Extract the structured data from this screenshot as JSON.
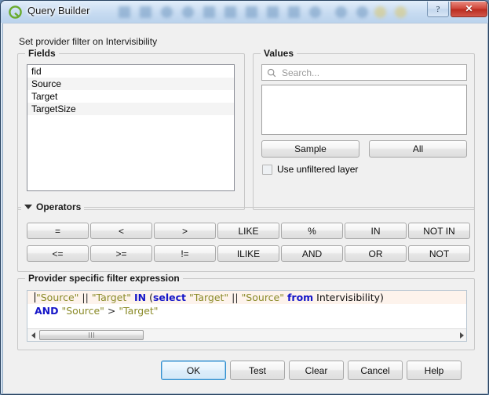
{
  "window": {
    "title": "Query Builder",
    "app_icon": "qgis-q-logo-icon",
    "help_button": "?",
    "close_button": "✕"
  },
  "subtitle": "Set provider filter on Intervisibility",
  "fields": {
    "group_label": "Fields",
    "items": [
      "fid",
      "Source",
      "Target",
      "TargetSize"
    ]
  },
  "values": {
    "group_label": "Values",
    "search_placeholder": "Search...",
    "search_value": "",
    "list_items": [],
    "sample_label": "Sample",
    "all_label": "All",
    "unfiltered_label": "Use unfiltered layer",
    "unfiltered_checked": false
  },
  "operators": {
    "group_label": "Operators",
    "collapsed": false,
    "row1": [
      "=",
      "<",
      ">",
      "LIKE",
      "%",
      "IN",
      "NOT IN"
    ],
    "row2": [
      "<=",
      ">=",
      "!=",
      "ILIKE",
      "AND",
      "OR",
      "NOT"
    ]
  },
  "expression": {
    "group_label": "Provider specific filter expression",
    "line1": [
      {
        "t": "\"Source\"",
        "k": "str"
      },
      {
        "t": " || ",
        "k": "op"
      },
      {
        "t": "\"Target\"",
        "k": "str"
      },
      {
        "t": " ",
        "k": "plain"
      },
      {
        "t": "IN",
        "k": "kw"
      },
      {
        "t": " (",
        "k": "plain"
      },
      {
        "t": "select",
        "k": "kw"
      },
      {
        "t": " ",
        "k": "plain"
      },
      {
        "t": "\"Target\"",
        "k": "str"
      },
      {
        "t": " || ",
        "k": "op"
      },
      {
        "t": "\"Source\"",
        "k": "str"
      },
      {
        "t": " ",
        "k": "plain"
      },
      {
        "t": "from",
        "k": "kw"
      },
      {
        "t": " Intervisibility)",
        "k": "plain"
      }
    ],
    "line2": [
      {
        "t": "AND",
        "k": "kw"
      },
      {
        "t": " ",
        "k": "plain"
      },
      {
        "t": "\"Source\"",
        "k": "str"
      },
      {
        "t": " > ",
        "k": "op"
      },
      {
        "t": "\"Target\"",
        "k": "str"
      }
    ],
    "plain_text": "\"Source\" || \"Target\" IN (select \"Target\" || \"Source\" from Intervisibility)\nAND \"Source\" > \"Target\""
  },
  "dialog_buttons": {
    "ok": "OK",
    "test": "Test",
    "clear": "Clear",
    "cancel": "Cancel",
    "help": "Help",
    "default_button": "OK"
  },
  "colors": {
    "dialog_bg": "#f0f0f0",
    "title_glass": "#c7dbf1",
    "close_red": "#c0392b",
    "keyword_blue": "#1616c8",
    "string_olive": "#8a8a27",
    "default_btn_border": "#2e8fd0",
    "current_line": "#fdf3ec"
  }
}
